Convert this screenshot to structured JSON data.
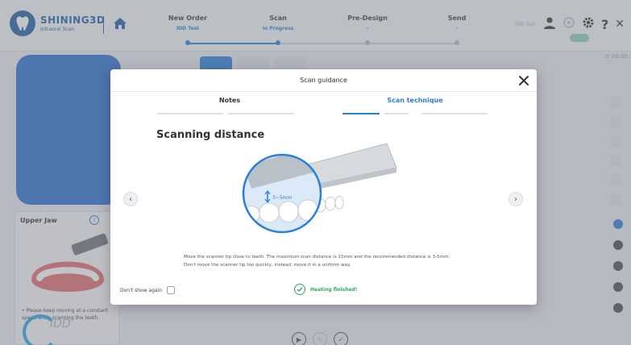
{
  "header": {
    "brand": "SHINING3D",
    "brand_sub": "Intraoral Scan",
    "steps": [
      {
        "title": "New Order",
        "sub": "IDD Test",
        "state": "done"
      },
      {
        "title": "Scan",
        "sub": "In Progress",
        "state": "active"
      },
      {
        "title": "Pre-Design",
        "sub": "-",
        "state": "pending"
      },
      {
        "title": "Send",
        "sub": "-",
        "state": "pending"
      }
    ],
    "faint_label": "IDD Test",
    "help_label": "?",
    "close_label": "✕"
  },
  "workspace": {
    "upper_jaw_title": "Upper Jaw",
    "upper_tip": "• Please keep moving at a constant speed while scanning the teeth.",
    "watermark": "IDD",
    "status_text": "⊙ 00:00"
  },
  "modal": {
    "title": "Scan guidance",
    "tabs": [
      {
        "label": "Notes",
        "active": false
      },
      {
        "label": "Scan technique",
        "active": true
      }
    ],
    "section_title": "Scanning distance",
    "distance_label": "3~5mm",
    "description": "Move the scanner tip close to teeth. The maximum scan distance is 15mm and the recommended distance is 3-5mm. Don't move the scanner tip too quickly, instead, move it in a uniform way.",
    "dont_show_label": "Don't show again",
    "heating_status": "Heating finished!",
    "prev_label": "‹",
    "next_label": "›"
  },
  "colors": {
    "brand_blue": "#1f5fa8",
    "accent_blue": "#2a7fd9",
    "success_green": "#2fa866",
    "scan_preview_blue": "#2b6fcf"
  }
}
